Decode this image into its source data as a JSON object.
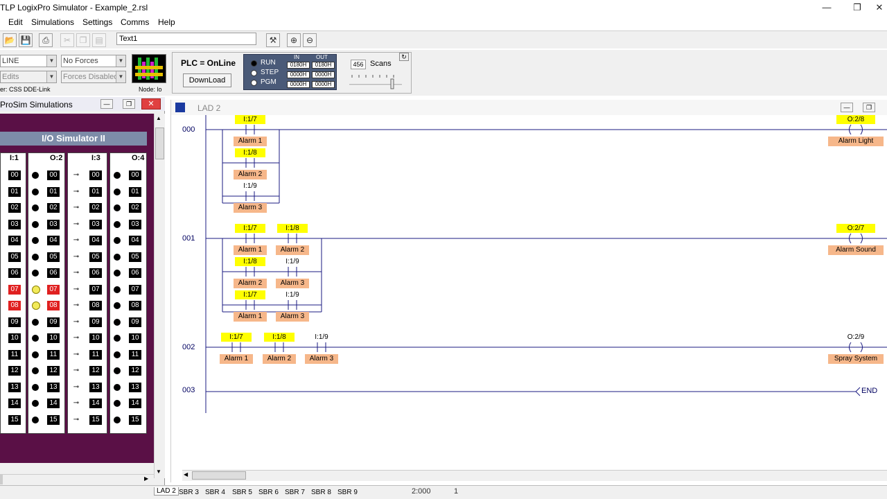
{
  "window": {
    "title": "TLP LogixPro Simulator  -  Example_2.rsl",
    "controls": {
      "minimize": "—",
      "maximize": "❐",
      "close": "✕"
    }
  },
  "menu": [
    "Edit",
    "Simulations",
    "Settings",
    "Comms",
    "Help"
  ],
  "toolbar": {
    "text_field": "Text1"
  },
  "status": {
    "mode_combo": "LINE",
    "edits_combo": "Edits",
    "forces_combo": "No Forces",
    "forces_disabled_combo": "Forces Disabled",
    "driver_label": "er: CSS DDE-Link",
    "node_label": "Node: lo",
    "plc_status": "PLC = OnLine",
    "download_label": "DownLoad",
    "modes": [
      "RUN",
      "STEP",
      "PGM"
    ],
    "in_label": "IN",
    "out_label": "OUT",
    "in_values": [
      "0180H",
      "0000H",
      "0000H"
    ],
    "out_values": [
      "0180H",
      "0000H",
      "0000H"
    ],
    "scan_count": "456",
    "scans_label": "Scans"
  },
  "simulator": {
    "window_title": "ProSim Simulations",
    "heading": "I/O Simulator II",
    "columns": [
      {
        "label": "I:1",
        "type": "input",
        "on_bits": [
          "07",
          "08"
        ]
      },
      {
        "label": "O:2",
        "type": "output",
        "on_bits": [
          "07",
          "08"
        ]
      },
      {
        "label": "I:3",
        "type": "input",
        "on_bits": []
      },
      {
        "label": "O:4",
        "type": "output",
        "on_bits": []
      }
    ],
    "bits": [
      "00",
      "01",
      "02",
      "03",
      "04",
      "05",
      "06",
      "07",
      "08",
      "09",
      "10",
      "11",
      "12",
      "13",
      "14",
      "15"
    ]
  },
  "ladder": {
    "window_title": "LAD 2",
    "rungs": [
      {
        "number": "000",
        "branches": [
          [
            {
              "addr": "I:1/7",
              "desc": "Alarm 1",
              "hl": true
            }
          ],
          [
            {
              "addr": "I:1/8",
              "desc": "Alarm 2",
              "hl": true
            }
          ],
          [
            {
              "addr": "I:1/9",
              "desc": "Alarm 3",
              "hl": false
            }
          ]
        ],
        "output": {
          "addr": "O:2/8",
          "desc": "Alarm Light",
          "hl": true
        }
      },
      {
        "number": "001",
        "branches": [
          [
            {
              "addr": "I:1/7",
              "desc": "Alarm 1",
              "hl": true
            },
            {
              "addr": "I:1/8",
              "desc": "Alarm 2",
              "hl": true
            }
          ],
          [
            {
              "addr": "I:1/8",
              "desc": "Alarm 2",
              "hl": true
            },
            {
              "addr": "I:1/9",
              "desc": "Alarm 3",
              "hl": false
            }
          ],
          [
            {
              "addr": "I:1/7",
              "desc": "Alarm 1",
              "hl": true
            },
            {
              "addr": "I:1/9",
              "desc": "Alarm 3",
              "hl": false
            }
          ]
        ],
        "output": {
          "addr": "O:2/7",
          "desc": "Alarm Sound",
          "hl": true
        }
      },
      {
        "number": "002",
        "branches": [
          [
            {
              "addr": "I:1/7",
              "desc": "Alarm 1",
              "hl": true
            },
            {
              "addr": "I:1/8",
              "desc": "Alarm 2",
              "hl": true
            },
            {
              "addr": "I:1/9",
              "desc": "Alarm 3",
              "hl": false
            }
          ]
        ],
        "output": {
          "addr": "O:2/9",
          "desc": "Spray System",
          "hl": false
        }
      },
      {
        "number": "003",
        "end_label": "END"
      }
    ]
  },
  "bottom": {
    "tabs": [
      "LAD 2",
      "SBR 3",
      "SBR 4",
      "SBR 5",
      "SBR 6",
      "SBR 7",
      "SBR 8",
      "SBR 9"
    ],
    "position": "2:000",
    "count": "1"
  }
}
